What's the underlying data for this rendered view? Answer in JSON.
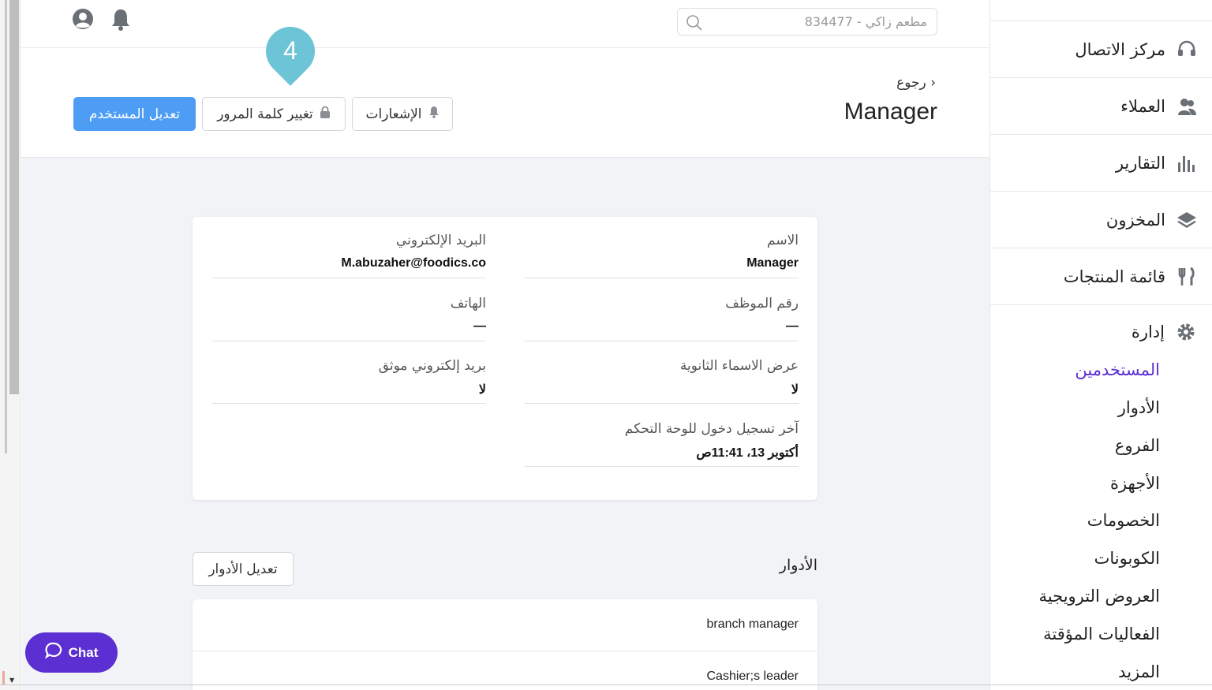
{
  "topbar": {
    "search_placeholder": "مطعم زاكي - 834477"
  },
  "header": {
    "back_label": "رجوع",
    "title": "Manager",
    "edit_user_label": "تعديل المستخدم",
    "change_password_label": "تغيير كلمة المرور",
    "notifications_label": "الإشعارات",
    "marker_number": "4"
  },
  "details": {
    "name_label": "الاسم",
    "name_value": "Manager",
    "email_label": "البريد الإلكتروني",
    "email_value": "M.abuzaher@foodics.co",
    "employee_number_label": "رقم الموظف",
    "employee_number_value": "—",
    "phone_label": "الهاتف",
    "phone_value": "—",
    "secondary_names_label": "عرض الاسماء الثانوية",
    "secondary_names_value": "لا",
    "verified_email_label": "بريد إلكتروني موثق",
    "verified_email_value": "لا",
    "last_login_label": "آخر تسجيل دخول للوحة التحكم",
    "last_login_value": "أكتوبر 13، 11:41ص"
  },
  "roles": {
    "title": "الأدوار",
    "edit_label": "تعديل الأدوار",
    "items": [
      "branch manager",
      "Cashier;s leader"
    ]
  },
  "chat": {
    "label": "Chat"
  },
  "sidebar": {
    "items": [
      {
        "label": "مركز الاتصال",
        "icon": "headset-icon"
      },
      {
        "label": "العملاء",
        "icon": "customers-icon"
      },
      {
        "label": "التقارير",
        "icon": "bar-chart-icon"
      },
      {
        "label": "المخزون",
        "icon": "layers-icon"
      },
      {
        "label": "قائمة المنتجات",
        "icon": "utensils-icon"
      }
    ],
    "admin_label": "إدارة",
    "sub_items": [
      "المستخدمين",
      "الأدوار",
      "الفروع",
      "الأجهزة",
      "الخصومات",
      "الكوبونات",
      "العروض الترويجية",
      "الفعاليات المؤقتة",
      "المزيد"
    ]
  },
  "colors": {
    "primary": "#4e9df5",
    "accent": "#5b2fd1",
    "marker": "#6cc4d6"
  }
}
